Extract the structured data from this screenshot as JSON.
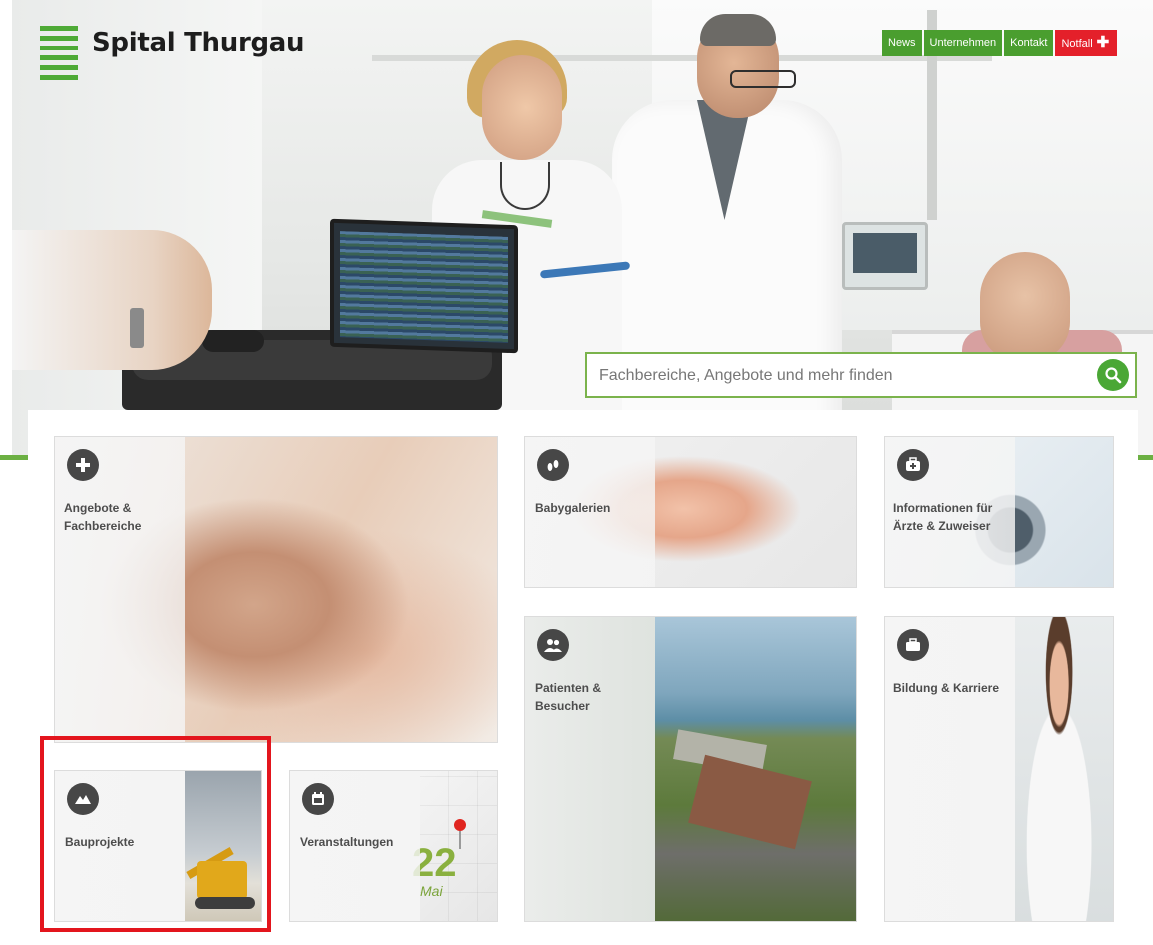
{
  "brand": {
    "name": "Spital Thurgau",
    "accent": "#4eaa36",
    "alert": "#e4202a"
  },
  "topnav": {
    "items": [
      "News",
      "Unternehmen",
      "Kontakt"
    ],
    "notfall": "Notfall"
  },
  "search": {
    "placeholder": "Fachbereiche, Angebote und mehr finden",
    "value": ""
  },
  "tiles": {
    "angebote": {
      "label_line1": "Angebote &",
      "label_line2": "Fachbereiche",
      "icon": "plus-circle-icon"
    },
    "baby": {
      "label": "Babygalerien",
      "icon": "footprints-icon"
    },
    "aerzte": {
      "label_line1": "Informationen für",
      "label_line2": "Ärzte & Zuweiser",
      "icon": "medical-bag-icon"
    },
    "patienten": {
      "label_line1": "Patienten &",
      "label_line2": "Besucher",
      "icon": "people-icon"
    },
    "bildung": {
      "label": "Bildung & Karriere",
      "icon": "briefcase-icon"
    },
    "bau": {
      "label": "Bauprojekte",
      "icon": "hills-icon"
    },
    "events": {
      "label": "Veranstaltungen",
      "icon": "calendar-icon",
      "calendar_day": "22",
      "calendar_month": "Mai"
    }
  },
  "highlight_color": "#e3151d"
}
